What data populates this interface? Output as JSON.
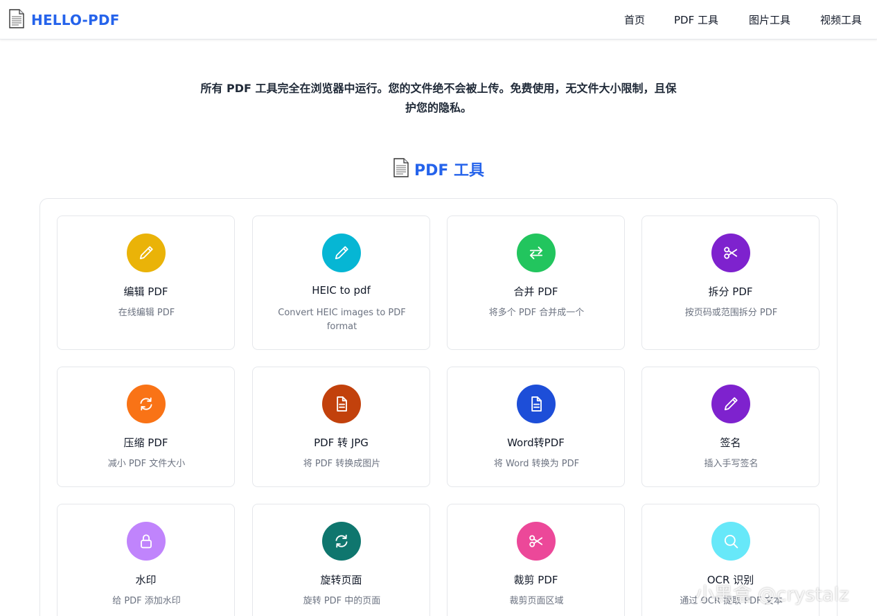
{
  "header": {
    "logo_icon": "document-icon",
    "logo_text": "HELLO-PDF",
    "nav": [
      {
        "label": "首页"
      },
      {
        "label": "PDF 工具"
      },
      {
        "label": "图片工具"
      },
      {
        "label": "视频工具"
      }
    ]
  },
  "intro": {
    "line1": "所有 PDF 工具完全在浏览器中运行。您的文件绝不会被上传。免费使用，无文件大小限制，且保",
    "line2": "护您的隐私。"
  },
  "section": {
    "icon": "document-icon",
    "title": "PDF 工具"
  },
  "tools": [
    {
      "title": "编辑 PDF",
      "desc": "在线编辑 PDF",
      "icon": "pencil-icon",
      "color": "#eab308"
    },
    {
      "title": "HEIC to pdf",
      "desc": "Convert HEIC images to PDF format",
      "icon": "pencil-icon",
      "color": "#06b6d4"
    },
    {
      "title": "合并 PDF",
      "desc": "将多个 PDF 合并成一个",
      "icon": "swap-arrows-icon",
      "color": "#22c55e"
    },
    {
      "title": "拆分 PDF",
      "desc": "按页码或范围拆分 PDF",
      "icon": "scissors-icon",
      "color": "#7e22ce"
    },
    {
      "title": "压缩 PDF",
      "desc": "减小 PDF 文件大小",
      "icon": "refresh-icon",
      "color": "#f97316"
    },
    {
      "title": "PDF 转 JPG",
      "desc": "将 PDF 转换成图片",
      "icon": "file-icon",
      "color": "#c2410c"
    },
    {
      "title": "Word转PDF",
      "desc": "将 Word 转换为 PDF",
      "icon": "file-icon",
      "color": "#1d4ed8"
    },
    {
      "title": "签名",
      "desc": "插入手写签名",
      "icon": "pencil-icon",
      "color": "#7e22ce"
    },
    {
      "title": "水印",
      "desc": "给 PDF 添加水印",
      "icon": "lock-icon",
      "color": "#c084fc"
    },
    {
      "title": "旋转页面",
      "desc": "旋转 PDF 中的页面",
      "icon": "refresh-icon",
      "color": "#0f766e"
    },
    {
      "title": "裁剪 PDF",
      "desc": "裁剪页面区域",
      "icon": "scissors-icon",
      "color": "#ec4899"
    },
    {
      "title": "OCR 识别",
      "desc": "通过 OCR 提取 PDF 文本",
      "icon": "search-icon",
      "color": "#67e8f9"
    }
  ],
  "watermark": "小黑盒 @crystalz"
}
